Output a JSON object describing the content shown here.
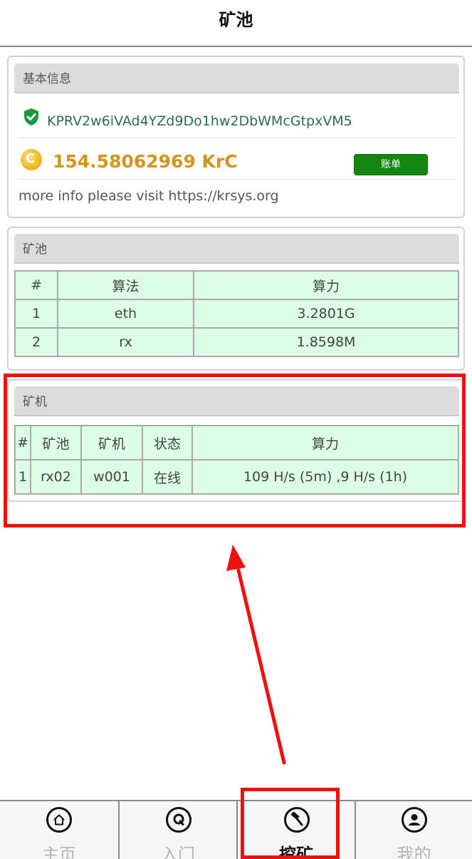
{
  "header": {
    "title": "矿池"
  },
  "info_panel": {
    "title": "基本信息",
    "address": "KPRV2w6iVAd4YZd9Do1hw2DbWMcGtpxVM5",
    "balance": "154.58062969 KrC",
    "coin_symbol": "C",
    "bill_button": "账单",
    "more_info": "more info please visit https://krsys.org"
  },
  "pool_panel": {
    "title": "矿池",
    "columns": [
      "#",
      "算法",
      "算力"
    ],
    "rows": [
      [
        "1",
        "eth",
        "3.2801G"
      ],
      [
        "2",
        "rx",
        "1.8598M"
      ]
    ]
  },
  "miner_panel": {
    "title": "矿机",
    "columns": [
      "#",
      "矿池",
      "矿机",
      "状态",
      "算力"
    ],
    "rows": [
      [
        "1",
        "rx02",
        "w001",
        "在线",
        "109 H/s (5m) ,9 H/s (1h)"
      ]
    ]
  },
  "tabbar": {
    "items": [
      {
        "label": "主页",
        "icon": "home-icon"
      },
      {
        "label": "入门",
        "icon": "q-icon"
      },
      {
        "label": "挖矿",
        "icon": "hammer-icon",
        "active": true
      },
      {
        "label": "我的",
        "icon": "user-icon"
      }
    ]
  },
  "colors": {
    "accent_green": "#13860f",
    "balance_gold": "#d4941e",
    "table_bg": "#dcfde6",
    "highlight_red": "#f01010"
  }
}
